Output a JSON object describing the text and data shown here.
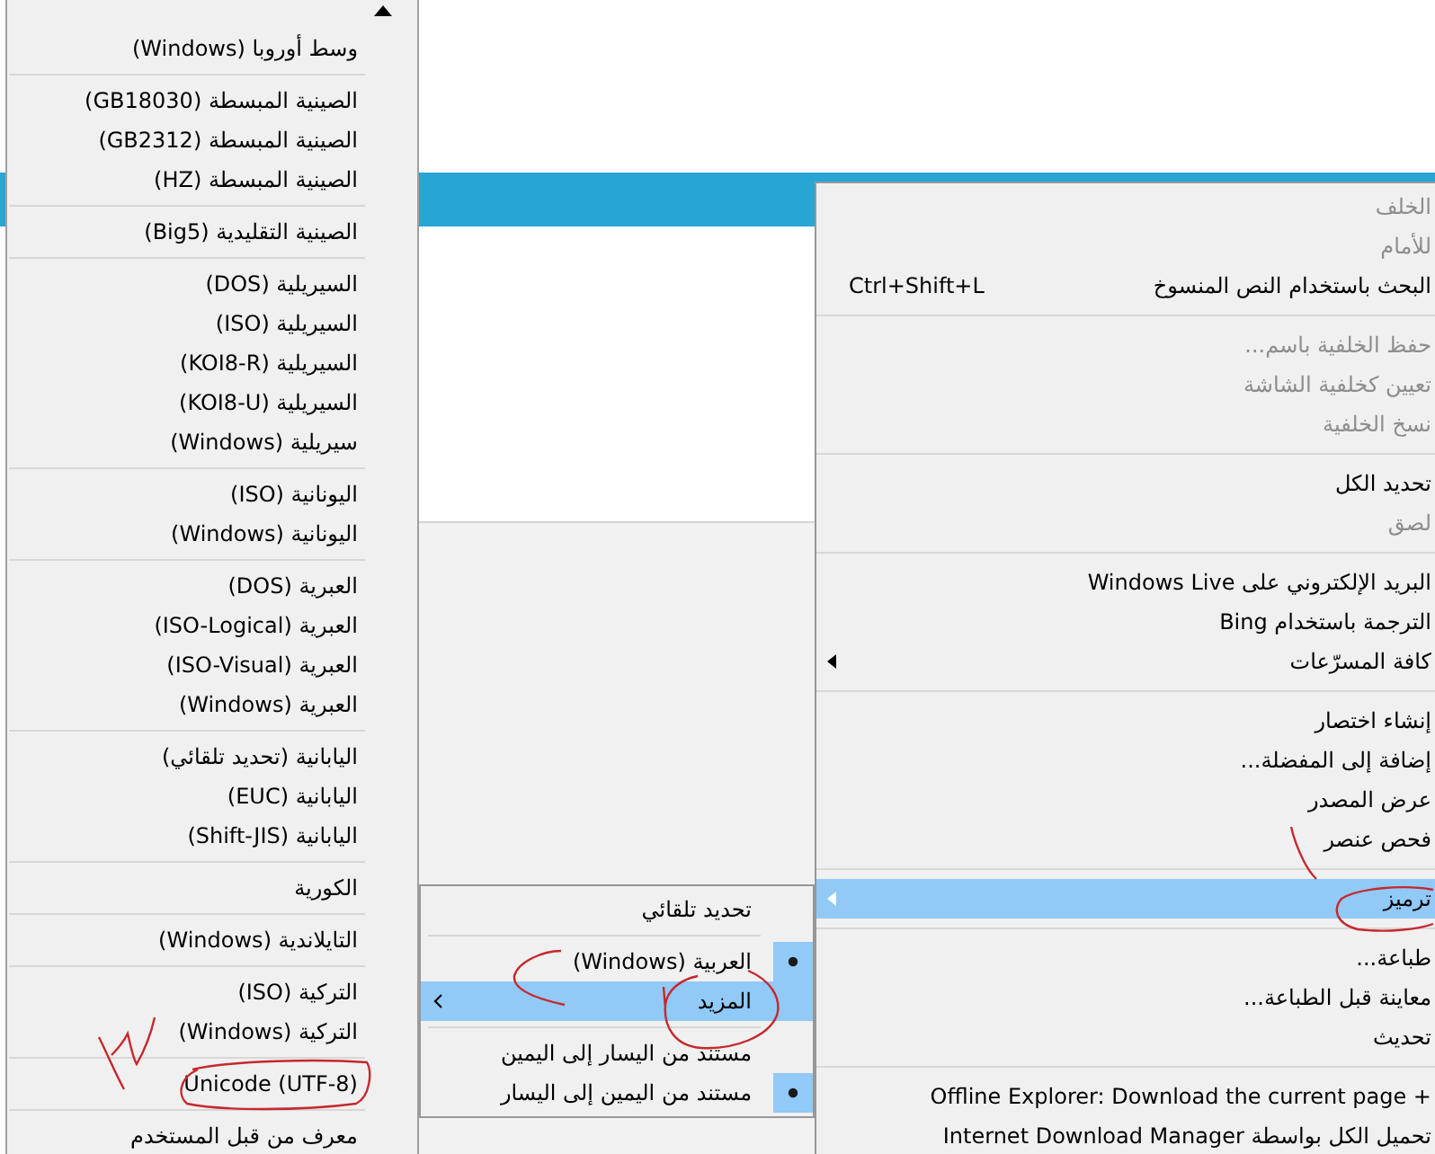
{
  "encoding_list_menu": {
    "groups": [
      {
        "items": [
          {
            "label": "وسط أوروبا (Windows)"
          }
        ]
      },
      {
        "items": [
          {
            "label": "الصينية المبسطة (GB18030)"
          },
          {
            "label": "الصينية المبسطة (GB2312)"
          },
          {
            "label": "الصينية المبسطة (HZ)"
          }
        ]
      },
      {
        "items": [
          {
            "label": "الصينية التقليدية (Big5)"
          }
        ]
      },
      {
        "items": [
          {
            "label": "السيريلية (DOS)"
          },
          {
            "label": "السيريلية (ISO)"
          },
          {
            "label": "السيريلية (KOI8-R)"
          },
          {
            "label": "السيريلية (KOI8-U)"
          },
          {
            "label": "سيريلية (Windows)"
          }
        ]
      },
      {
        "items": [
          {
            "label": "اليونانية (ISO)"
          },
          {
            "label": "اليونانية (Windows)"
          }
        ]
      },
      {
        "items": [
          {
            "label": "العبرية (DOS)"
          },
          {
            "label": "العبرية (ISO-Logical)"
          },
          {
            "label": "العبرية (ISO-Visual)"
          },
          {
            "label": "العبرية (Windows)"
          }
        ]
      },
      {
        "items": [
          {
            "label": "اليابانية (تحديد تلقائي)"
          },
          {
            "label": "اليابانية (EUC)"
          },
          {
            "label": "اليابانية (Shift-JIS)"
          }
        ]
      },
      {
        "items": [
          {
            "label": "الكورية"
          }
        ]
      },
      {
        "items": [
          {
            "label": "التايلاندية (Windows)"
          }
        ]
      },
      {
        "items": [
          {
            "label": "التركية (ISO)"
          },
          {
            "label": "التركية (Windows)"
          }
        ]
      },
      {
        "items": [
          {
            "label": "Unicode (UTF-8)"
          }
        ]
      },
      {
        "items": [
          {
            "label": "معرف من قبل المستخدم"
          }
        ]
      }
    ]
  },
  "context_menu": {
    "groups": [
      {
        "items": [
          {
            "label": "الخلف",
            "disabled": true,
            "selected": false,
            "submenu": false
          },
          {
            "label": "للأمام",
            "disabled": true,
            "selected": false,
            "submenu": false
          },
          {
            "label": "البحث باستخدام النص المنسوخ",
            "shortcut": "Ctrl+Shift+L",
            "disabled": false,
            "selected": false,
            "submenu": false
          }
        ]
      },
      {
        "items": [
          {
            "label": "حفظ الخلفية باسم...",
            "disabled": true,
            "selected": false,
            "submenu": false
          },
          {
            "label": "تعيين كخلفية الشاشة",
            "disabled": true,
            "selected": false,
            "submenu": false
          },
          {
            "label": "نسخ الخلفية",
            "disabled": true,
            "selected": false,
            "submenu": false
          }
        ]
      },
      {
        "items": [
          {
            "label": "تحديد الكل",
            "disabled": false,
            "selected": false,
            "submenu": false
          },
          {
            "label": "لصق",
            "disabled": true,
            "selected": false,
            "submenu": false
          }
        ]
      },
      {
        "items": [
          {
            "label": "البريد الإلكتروني على Windows Live",
            "disabled": false,
            "selected": false,
            "submenu": false
          },
          {
            "label": "الترجمة باستخدام Bing",
            "disabled": false,
            "selected": false,
            "submenu": false
          },
          {
            "label": "كافة المسرّعات",
            "disabled": false,
            "selected": false,
            "submenu": true
          }
        ]
      },
      {
        "items": [
          {
            "label": "إنشاء اختصار",
            "disabled": false,
            "selected": false,
            "submenu": false
          },
          {
            "label": "إضافة إلى المفضلة...",
            "disabled": false,
            "selected": false,
            "submenu": false
          },
          {
            "label": "عرض المصدر",
            "disabled": false,
            "selected": false,
            "submenu": false
          },
          {
            "label": "فحص عنصر",
            "disabled": false,
            "selected": false,
            "submenu": false
          }
        ]
      },
      {
        "items": [
          {
            "label": "ترميز",
            "disabled": false,
            "selected": true,
            "submenu": true
          }
        ]
      },
      {
        "items": [
          {
            "label": "طباعة...",
            "disabled": false,
            "selected": false,
            "submenu": false
          },
          {
            "label": "معاينة قبل الطباعة...",
            "disabled": false,
            "selected": false,
            "submenu": false
          },
          {
            "label": "تحديث",
            "disabled": false,
            "selected": false,
            "submenu": false
          }
        ]
      },
      {
        "items": [
          {
            "label": "Offline Explorer: Download the current page +",
            "disabled": false,
            "selected": false,
            "submenu": false
          },
          {
            "label": "تحميل الكل بواسطة Internet Download Manager",
            "disabled": false,
            "selected": false,
            "submenu": false
          }
        ]
      }
    ]
  },
  "encoding_submenu": {
    "groups": [
      {
        "items": [
          {
            "label": "تحديد تلقائي",
            "checked": false,
            "selected": false,
            "submenu": false
          }
        ]
      },
      {
        "items": [
          {
            "label": "العربية (Windows)",
            "checked": true,
            "selected": false,
            "submenu": false
          },
          {
            "label": "المزيد",
            "checked": false,
            "selected": true,
            "submenu": true
          }
        ]
      },
      {
        "items": [
          {
            "label": "مستند من اليسار إلى اليمين",
            "checked": false,
            "selected": false,
            "submenu": false
          },
          {
            "label": "مستند من اليمين إلى اليسار",
            "checked": true,
            "selected": false,
            "submenu": false
          }
        ]
      }
    ]
  }
}
